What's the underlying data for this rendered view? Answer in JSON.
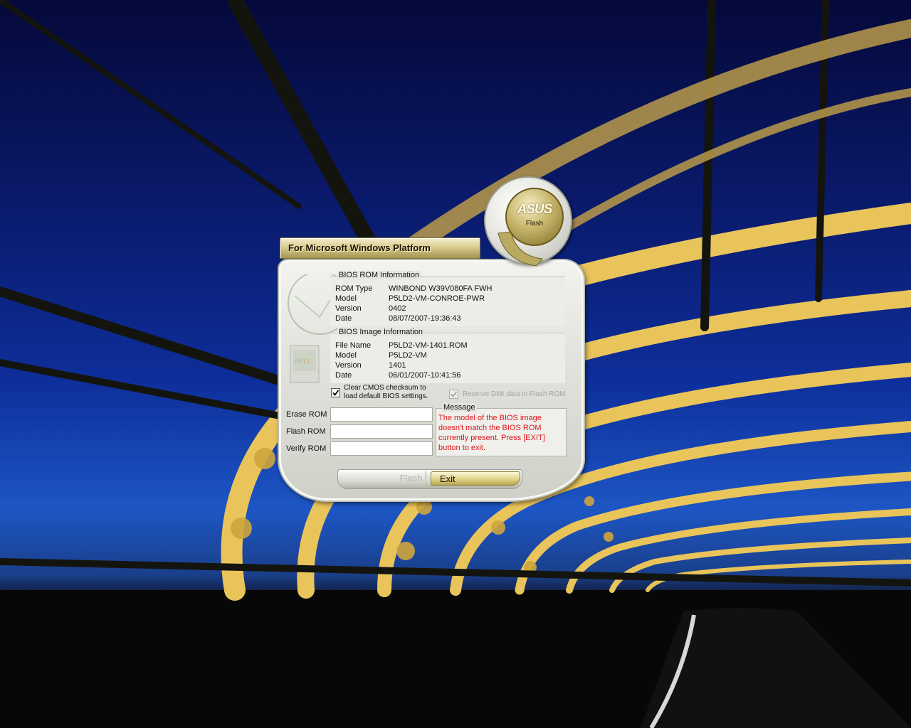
{
  "window": {
    "platform_banner": "For Microsoft Windows Platform",
    "logo_brand": "ASUS",
    "logo_label": "Flash"
  },
  "rom_info": {
    "title": "BIOS ROM Information",
    "rows": [
      {
        "label": "ROM Type",
        "value": "WINBOND W39V080FA FWH"
      },
      {
        "label": "Model",
        "value": "P5LD2-VM-CONROE-PWR"
      },
      {
        "label": "Version",
        "value": "0402"
      },
      {
        "label": "Date",
        "value": "08/07/2007-19:36:43"
      }
    ]
  },
  "image_info": {
    "title": "BIOS Image Information",
    "rows": [
      {
        "label": "File Name",
        "value": "P5LD2-VM-1401.ROM"
      },
      {
        "label": "Model",
        "value": "P5LD2-VM"
      },
      {
        "label": "Version",
        "value": "1401"
      },
      {
        "label": "Date",
        "value": "06/01/2007-10:41:56"
      }
    ]
  },
  "options": {
    "clear_cmos": {
      "label_line1": "Clear CMOS checksum to",
      "label_line2": "load default BIOS settings.",
      "checked": true
    },
    "reserve_dmi": {
      "label": "Reserve DMI data in Flash ROM",
      "checked": true,
      "enabled": false
    }
  },
  "progress": {
    "erase": {
      "label": "Erase ROM",
      "value": 0
    },
    "flash": {
      "label": "Flash ROM",
      "value": 0
    },
    "verify": {
      "label": "Verify ROM",
      "value": 0
    }
  },
  "message": {
    "title": "Message",
    "text": "The model of the BIOS image doesn't match the BIOS ROM currently present. Press [EXIT] button to exit.",
    "color": "#e0141a"
  },
  "buttons": {
    "flash": {
      "label": "Flash",
      "enabled": false
    },
    "exit": {
      "label": "Exit",
      "enabled": true
    }
  },
  "colors": {
    "accent_gold": "#c6b56a",
    "panel": "#e2e3dd",
    "sky": "#0d2e9a"
  }
}
